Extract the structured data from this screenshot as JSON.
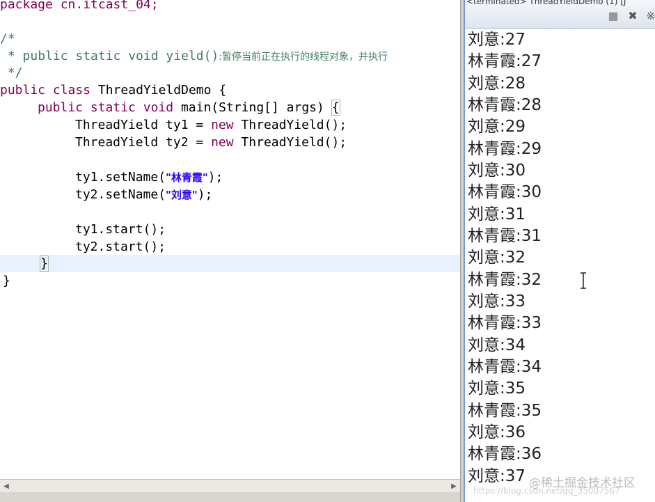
{
  "editor": {
    "package_line": "package cn.itcast_04;",
    "comment_open": "/*",
    "comment_prefix": " * ",
    "comment_signature": "public static void yield()",
    "comment_desc": ":暂停当前正在执行的线程对象，并执行",
    "comment_close": " */",
    "class_kw1": "public",
    "class_kw2": "class",
    "class_name": " ThreadYieldDemo {",
    "main_kw1": "public",
    "main_kw2": "static",
    "main_kw3": "void",
    "main_sig": " main(String[] args) ",
    "main_brace": "{",
    "ty1_decl_a": "ThreadYield ty1 = ",
    "ty1_new": "new",
    "ty1_decl_b": " ThreadYield();",
    "ty2_decl_a": "ThreadYield ty2 = ",
    "ty2_new": "new",
    "ty2_decl_b": " ThreadYield();",
    "ty1_setname_a": "ty1.setName(",
    "ty1_setname_str": "\"林青霞\"",
    "ty1_setname_b": ");",
    "ty2_setname_a": "ty2.setName(",
    "ty2_setname_str": "\"刘意\"",
    "ty2_setname_b": ");",
    "ty1_start": "ty1.start();",
    "ty2_start": "ty2.start();",
    "close_main": "}",
    "close_class": "}"
  },
  "console": {
    "title": "<terminated> ThreadYieldDemo (1) [J",
    "output": [
      "刘意:27",
      "林青霞:27",
      "刘意:28",
      "林青霞:28",
      "刘意:29",
      "林青霞:29",
      "刘意:30",
      "林青霞:30",
      "刘意:31",
      "林青霞:31",
      "刘意:32",
      "林青霞:32",
      "刘意:33",
      "林青霞:33",
      "刘意:34",
      "林青霞:34",
      "刘意:35",
      "林青霞:35",
      "刘意:36",
      "林青霞:36",
      "刘意:37"
    ],
    "btn_stop": "■",
    "btn_remove": "✖",
    "btn_clear": "※"
  },
  "watermark": {
    "text": "@稀土掘金技术社区",
    "url": "https://blog.csdn.net/qq_35007567"
  }
}
